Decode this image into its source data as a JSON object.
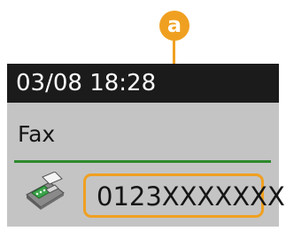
{
  "callout": {
    "label": "a",
    "color": "#f0a020"
  },
  "display": {
    "datetime": "03/08 18:28",
    "mode": "Fax",
    "mode_indicator_color": "#2d8a2d",
    "destination_icon": "fax-machine-icon",
    "fax_number": "0123XXXXXXX"
  }
}
